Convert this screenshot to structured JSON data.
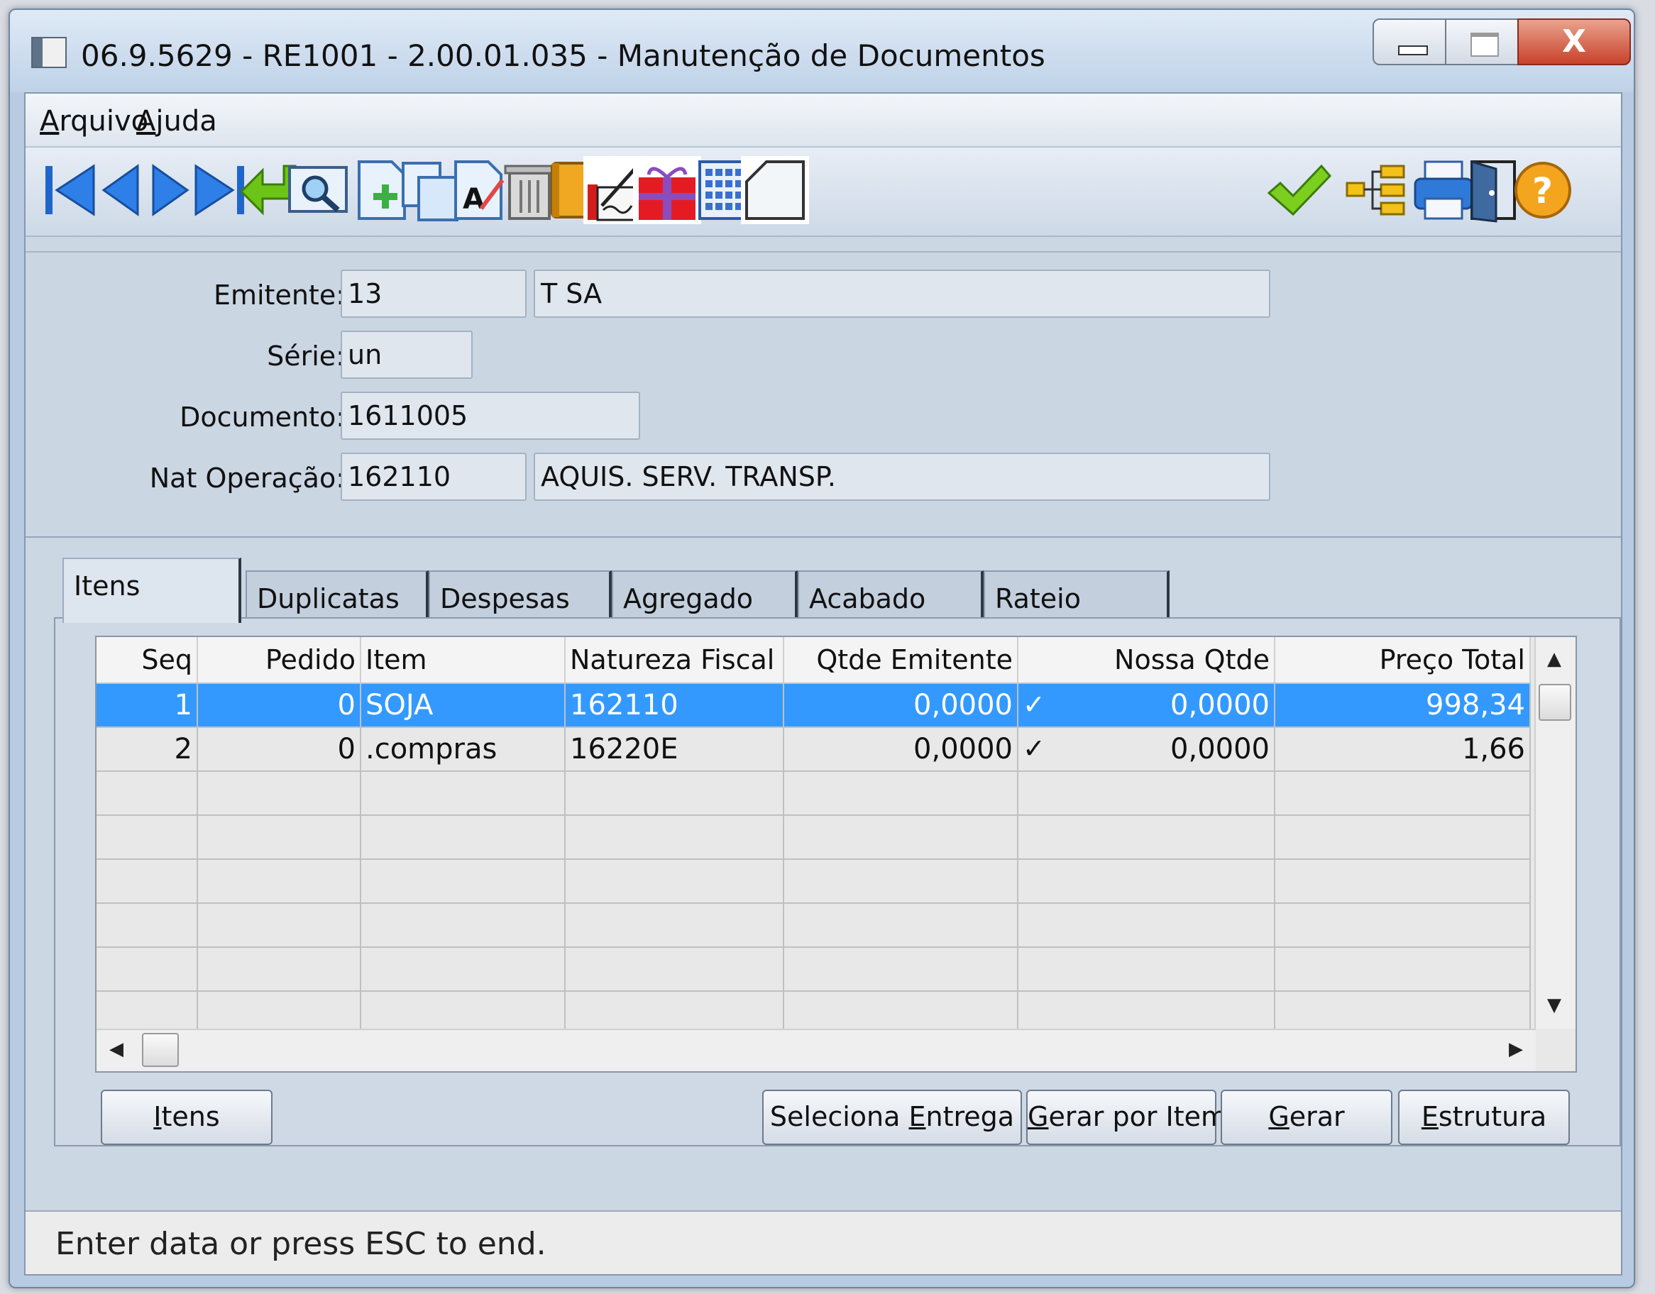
{
  "window": {
    "title": "06.9.5629 - RE1001 - 2.00.01.035 - Manutenção de Documentos",
    "close_glyph": "X"
  },
  "menu": {
    "arquivo": {
      "first": "A",
      "rest": "rquivo"
    },
    "ajuda": {
      "first": "A",
      "rest": "juda"
    }
  },
  "toolbar": {
    "icons": [
      "first-record-icon",
      "previous-record-icon",
      "next-record-icon",
      "last-record-icon",
      "goto-icon",
      "search-icon",
      "new-icon",
      "copy-icon",
      "edit-icon",
      "delete-icon",
      "book-icon",
      "sign-icon",
      "gift-icon",
      "calendar-icon",
      "blank-page-icon",
      "check-icon",
      "tree-icon",
      "print-icon",
      "exit-door-icon",
      "help-icon"
    ]
  },
  "form": {
    "emitente_label": "Emitente:",
    "emitente_code": "13",
    "emitente_name": "T SA",
    "serie_label": "Série:",
    "serie_value": "un",
    "documento_label": "Documento:",
    "documento_value": "1611005",
    "natop_label": "Nat Operação:",
    "natop_code": "162110",
    "natop_desc": "AQUIS. SERV. TRANSP."
  },
  "tabs": [
    "Itens",
    "Duplicatas",
    "Despesas",
    "Agregado",
    "Acabado",
    "Rateio"
  ],
  "grid": {
    "headers": [
      "Seq",
      "Pedido",
      "Item",
      "Natureza Fiscal",
      "Qtde Emitente",
      "Nossa Qtde",
      "Preço Total"
    ],
    "rows": [
      {
        "seq": "1",
        "pedido": "0",
        "item": "SOJA",
        "natureza": "162110",
        "qtde_emitente": "0,0000",
        "check": "✓",
        "nossa_qtde": "0,0000",
        "preco_total": "998,34"
      },
      {
        "seq": "2",
        "pedido": "0",
        "item": ".compras",
        "natureza": "16220E",
        "qtde_emitente": "0,0000",
        "check": "✓",
        "nossa_qtde": "0,0000",
        "preco_total": "1,66"
      }
    ]
  },
  "buttons": {
    "itens": {
      "first": "I",
      "rest": "tens"
    },
    "seleciona_entrega": {
      "pre": "Seleciona ",
      "u": "E",
      "post": "ntrega"
    },
    "gerar_por_item": {
      "u": "G",
      "post": "erar por Item"
    },
    "gerar": {
      "u": "G",
      "post": "erar"
    },
    "estrutura": {
      "u": "E",
      "post": "strutura"
    }
  },
  "status": "Enter data or press ESC to end."
}
